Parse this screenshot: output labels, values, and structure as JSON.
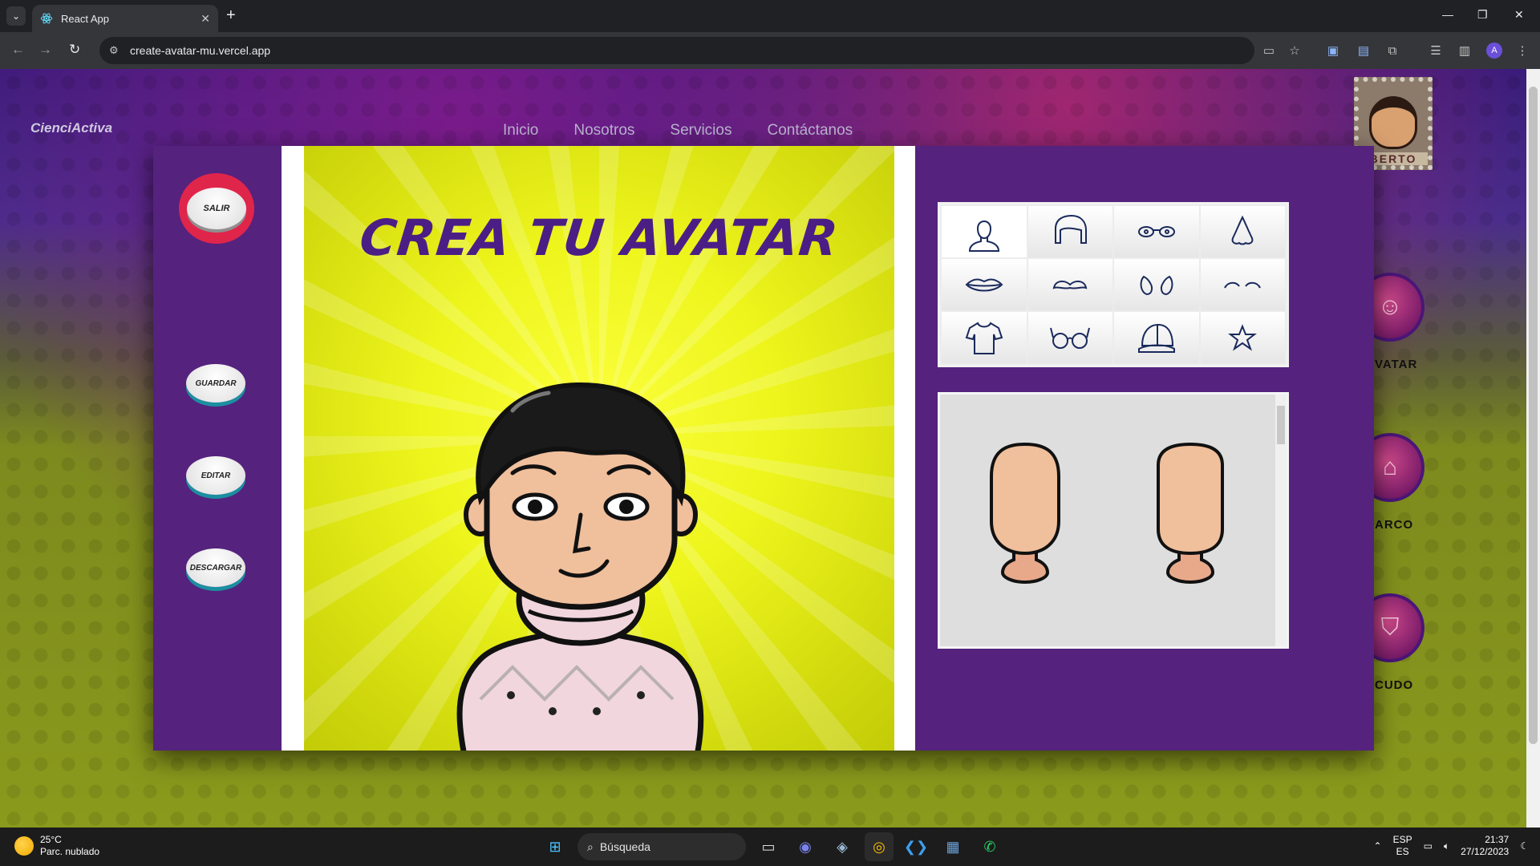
{
  "browser": {
    "tab_title": "React App",
    "url": "create-avatar-mu.vercel.app",
    "profile_initial": "A"
  },
  "site": {
    "logo": "CienciActiva",
    "nav": [
      "Inicio",
      "Nosotros",
      "Servicios",
      "Contáctanos"
    ],
    "stamp_name": "BERTO",
    "side_labels": [
      "VATAR",
      "ARCO",
      "CUDO"
    ]
  },
  "editor": {
    "title": "CREA TU AVATAR",
    "buttons": {
      "salir": "SALIR",
      "guardar": "GUARDAR",
      "editar": "EDITAR",
      "descargar": "DESCARGAR"
    },
    "categories": [
      {
        "icon": "face-shape-icon"
      },
      {
        "icon": "hair-icon"
      },
      {
        "icon": "eyes-icon"
      },
      {
        "icon": "nose-icon"
      },
      {
        "icon": "mouth-icon"
      },
      {
        "icon": "mustache-icon"
      },
      {
        "icon": "ears-icon"
      },
      {
        "icon": "eyebrows-icon"
      },
      {
        "icon": "shirt-icon"
      },
      {
        "icon": "glasses-icon"
      },
      {
        "icon": "cap-icon"
      },
      {
        "icon": "star-icon"
      }
    ],
    "active_category": 0,
    "skin_color": "#f0bf9c",
    "accent_purple": "#55227e",
    "salir_red": "#e0254b"
  },
  "taskbar": {
    "temperature": "25°C",
    "weather": "Parc. nublado",
    "search": "Búsqueda",
    "lang_top": "ESP",
    "lang_bottom": "ES",
    "time": "21:37",
    "date": "27/12/2023"
  }
}
